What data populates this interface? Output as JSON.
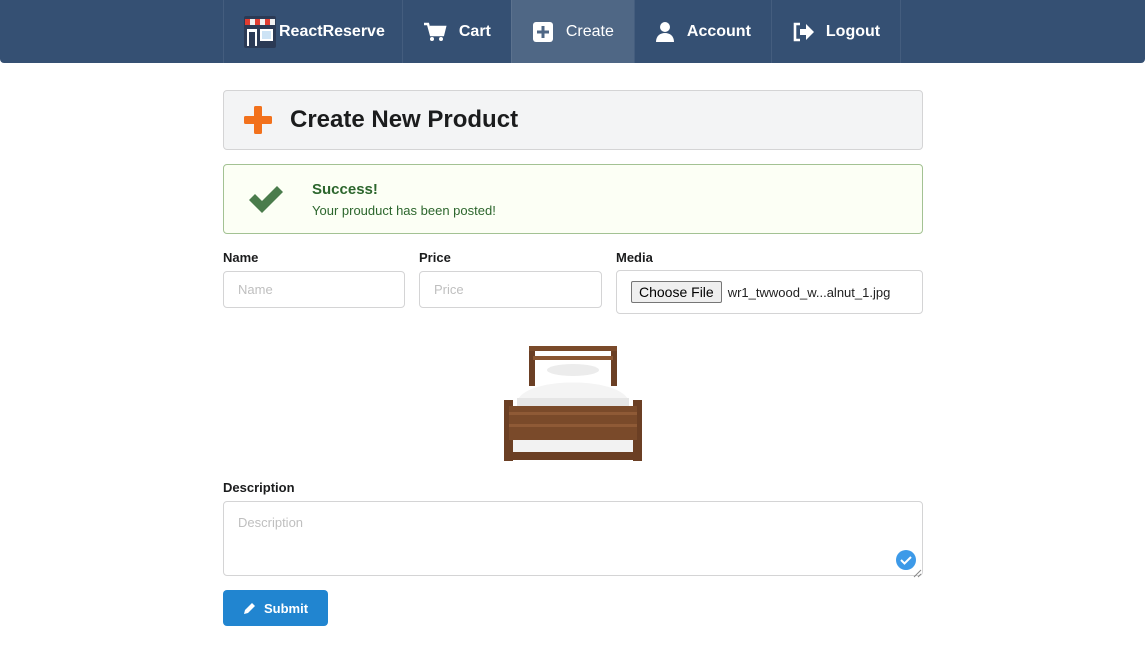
{
  "nav": {
    "brand": "ReactReserve",
    "items": [
      {
        "label": "Cart",
        "icon": "cart-icon"
      },
      {
        "label": "Create",
        "icon": "plus-square-icon"
      },
      {
        "label": "Account",
        "icon": "user-icon"
      },
      {
        "label": "Logout",
        "icon": "sign-out-icon"
      }
    ],
    "active": "Create"
  },
  "header": {
    "title": "Create New Product",
    "icon": "plus-icon",
    "icon_color": "#f2711c"
  },
  "message": {
    "title": "Success!",
    "body": "Your prouduct has been posted!",
    "icon": "checkmark-icon",
    "color": "#2c662d"
  },
  "form": {
    "name_label": "Name",
    "name_placeholder": "Name",
    "price_label": "Price",
    "price_placeholder": "Price",
    "media_label": "Media",
    "choose_file_label": "Choose File",
    "file_name": "wr1_twwood_w...alnut_1.jpg",
    "description_label": "Description",
    "description_placeholder": "Description",
    "submit_label": "Submit",
    "submit_icon": "pencil-icon"
  },
  "colors": {
    "navbar": "#355073",
    "primary": "#2185d0",
    "success_bg": "#fcfff5"
  }
}
